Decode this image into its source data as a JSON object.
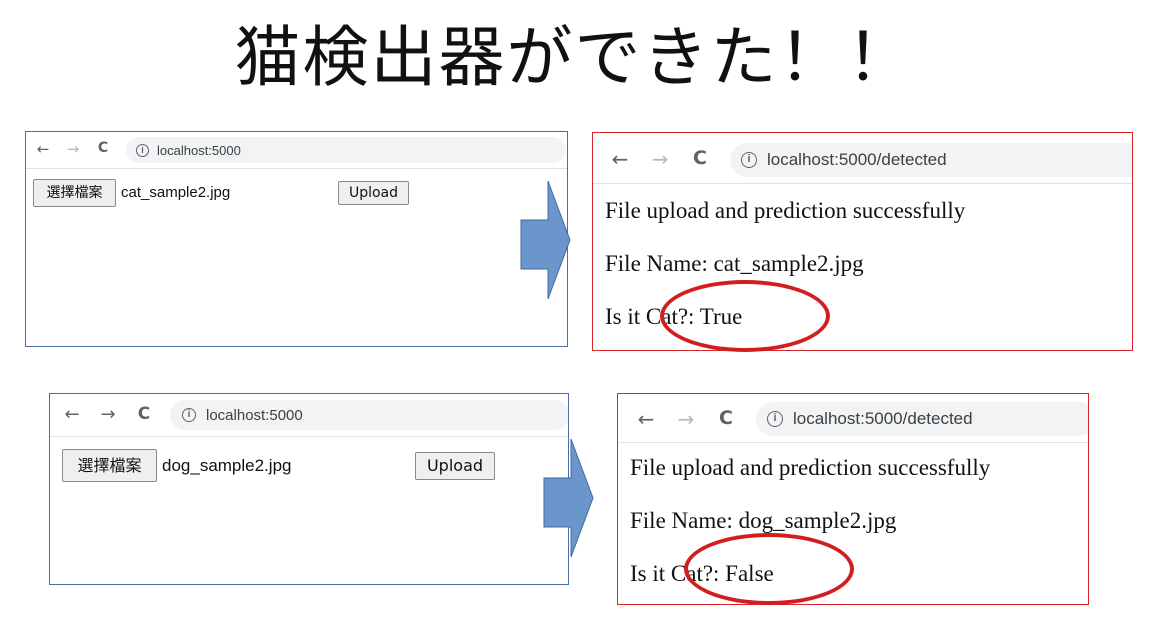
{
  "title": "猫検出器ができた！！",
  "nav_icons": {
    "back": "←",
    "forward": "→",
    "reload": "C",
    "info": "i"
  },
  "panels": [
    {
      "upload": {
        "url": "localhost:5000",
        "choose_label": "選擇檔案",
        "file_name": "cat_sample2.jpg",
        "upload_label": "Upload"
      },
      "result": {
        "url": "localhost:5000/detected",
        "message": "File upload and prediction successfully",
        "file_line": "File Name: cat_sample2.jpg",
        "cat_line": "Is it Cat?: True"
      }
    },
    {
      "upload": {
        "url": "localhost:5000",
        "choose_label": "選擇檔案",
        "file_name": "dog_sample2.jpg",
        "upload_label": "Upload"
      },
      "result": {
        "url": "localhost:5000/detected",
        "message": "File upload and prediction successfully",
        "file_line": "File Name: dog_sample2.jpg",
        "cat_line": "Is it Cat?: False"
      }
    }
  ],
  "colors": {
    "upload_border": "#4a6ea0",
    "result_border": "#d8262a",
    "arrow_fill": "#6a96cc",
    "highlight_ellipse": "#d11f1f"
  }
}
